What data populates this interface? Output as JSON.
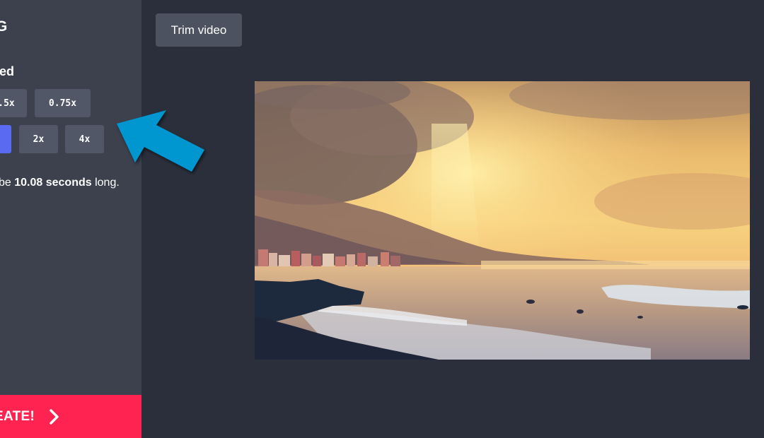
{
  "sidebar": {
    "title": "ING",
    "speed_label": "speed",
    "speed_options": [
      ".5x",
      "0.75x",
      "",
      "2x",
      "4x"
    ],
    "note_prefix": "be ",
    "note_bold": "10.08 seconds",
    "note_suffix": " long.",
    "create_label": "REATE!"
  },
  "toolbar": {
    "trim_label": "Trim video"
  },
  "colors": {
    "background": "#2b2f3b",
    "sidebar": "#3c414d",
    "button": "#515766",
    "active_button": "#5a6af1",
    "create_button": "#fe2350",
    "arrow": "#0096d0"
  },
  "icons": {
    "create_chevron": "chevron-right-icon",
    "pointer_arrow": "arrow-icon"
  }
}
